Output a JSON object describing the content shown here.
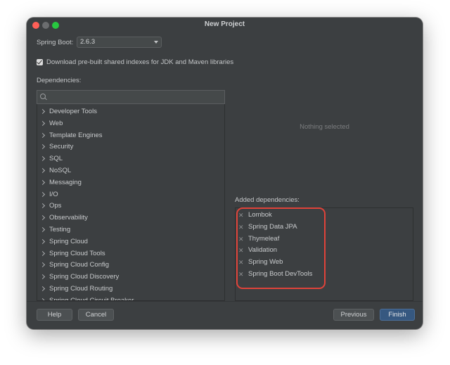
{
  "window": {
    "title": "New Project"
  },
  "spring_boot": {
    "label": "Spring Boot:",
    "selected_version": "2.6.3"
  },
  "download_indexes": {
    "label": "Download pre-built shared indexes for JDK and Maven libraries",
    "checked": true
  },
  "dependencies": {
    "label": "Dependencies:",
    "search": {
      "value": "",
      "placeholder": ""
    },
    "categories": [
      "Developer Tools",
      "Web",
      "Template Engines",
      "Security",
      "SQL",
      "NoSQL",
      "Messaging",
      "I/O",
      "Ops",
      "Observability",
      "Testing",
      "Spring Cloud",
      "Spring Cloud Tools",
      "Spring Cloud Config",
      "Spring Cloud Discovery",
      "Spring Cloud Routing",
      "Spring Cloud Circuit Breaker"
    ]
  },
  "details": {
    "empty_text": "Nothing selected"
  },
  "added_dependencies": {
    "label": "Added dependencies:",
    "items": [
      "Lombok",
      "Spring Data JPA",
      "Thymeleaf",
      "Validation",
      "Spring Web",
      "Spring Boot DevTools"
    ],
    "remove_glyph": "✕",
    "highlight_color": "#e0433a"
  },
  "buttons": {
    "help": "Help",
    "cancel": "Cancel",
    "previous": "Previous",
    "finish": "Finish"
  },
  "icons": {
    "search": "search-icon",
    "chevron": "chevron-right-icon",
    "remove": "close-icon",
    "dropdown": "chevron-down-icon"
  },
  "colors": {
    "window_bg": "#3c3f41",
    "accent": "#365880",
    "traffic_close": "#ff5f57",
    "traffic_zoom": "#28c840"
  }
}
